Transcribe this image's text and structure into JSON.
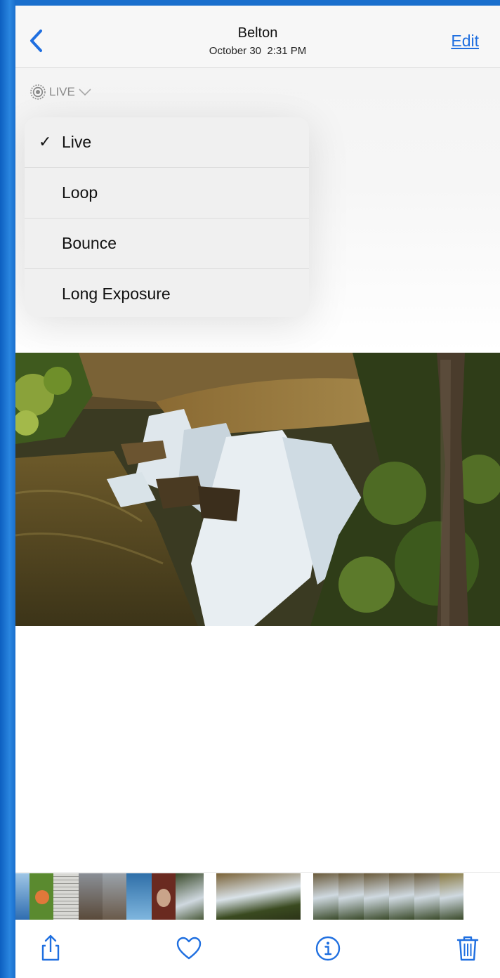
{
  "navbar": {
    "back_icon": "chevron-left-icon",
    "title": "Belton",
    "subtitle": "October 30  2:31 PM",
    "edit_label": "Edit"
  },
  "live_badge": {
    "icon": "live-photo-icon",
    "label": "LIVE",
    "chevron": "chevron-down-icon"
  },
  "menu": {
    "items": [
      {
        "label": "Live",
        "checked": true,
        "check": "✓"
      },
      {
        "label": "Loop",
        "checked": false,
        "check": ""
      },
      {
        "label": "Bounce",
        "checked": false,
        "check": ""
      },
      {
        "label": "Long Exposure",
        "checked": false,
        "check": ""
      }
    ]
  },
  "toolbar": {
    "share_icon": "share-icon",
    "favorite_icon": "heart-icon",
    "info_icon": "info-icon",
    "delete_icon": "trash-icon"
  },
  "colors": {
    "accent": "#1f6fe0",
    "background_edge": "#1a72d0"
  }
}
